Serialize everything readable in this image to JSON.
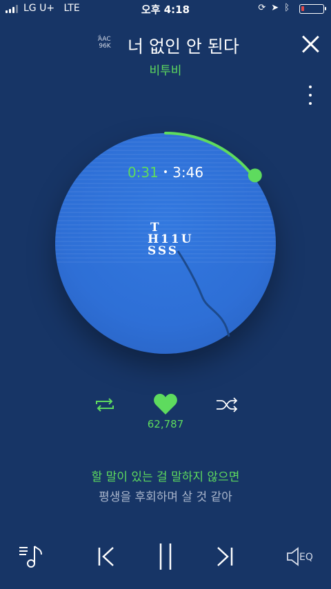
{
  "status_bar": {
    "carrier": "LG U+",
    "network": "LTE",
    "time": "오후 4:18",
    "battery_level": 0.15
  },
  "header": {
    "codec_line1": "AAC",
    "codec_line2": "96K",
    "song_title": "너 없인 안 된다",
    "artist": "비투비"
  },
  "player": {
    "current_time": "0:31",
    "separator": "•",
    "total_time": "3:46",
    "progress_fraction": 0.137,
    "album_logo_rows": [
      "T",
      "H11U",
      "SSS"
    ]
  },
  "actions": {
    "like_count": "62,787"
  },
  "lyrics": {
    "current": "할 말이 있는 걸 말하지 않으면",
    "next": "평생을 후회하며 살 것 같아"
  },
  "bottom_bar": {
    "eq_label": "EQ"
  },
  "colors": {
    "background": "#173566",
    "accent": "#5edb5e",
    "disc": "#2e6fd6"
  }
}
